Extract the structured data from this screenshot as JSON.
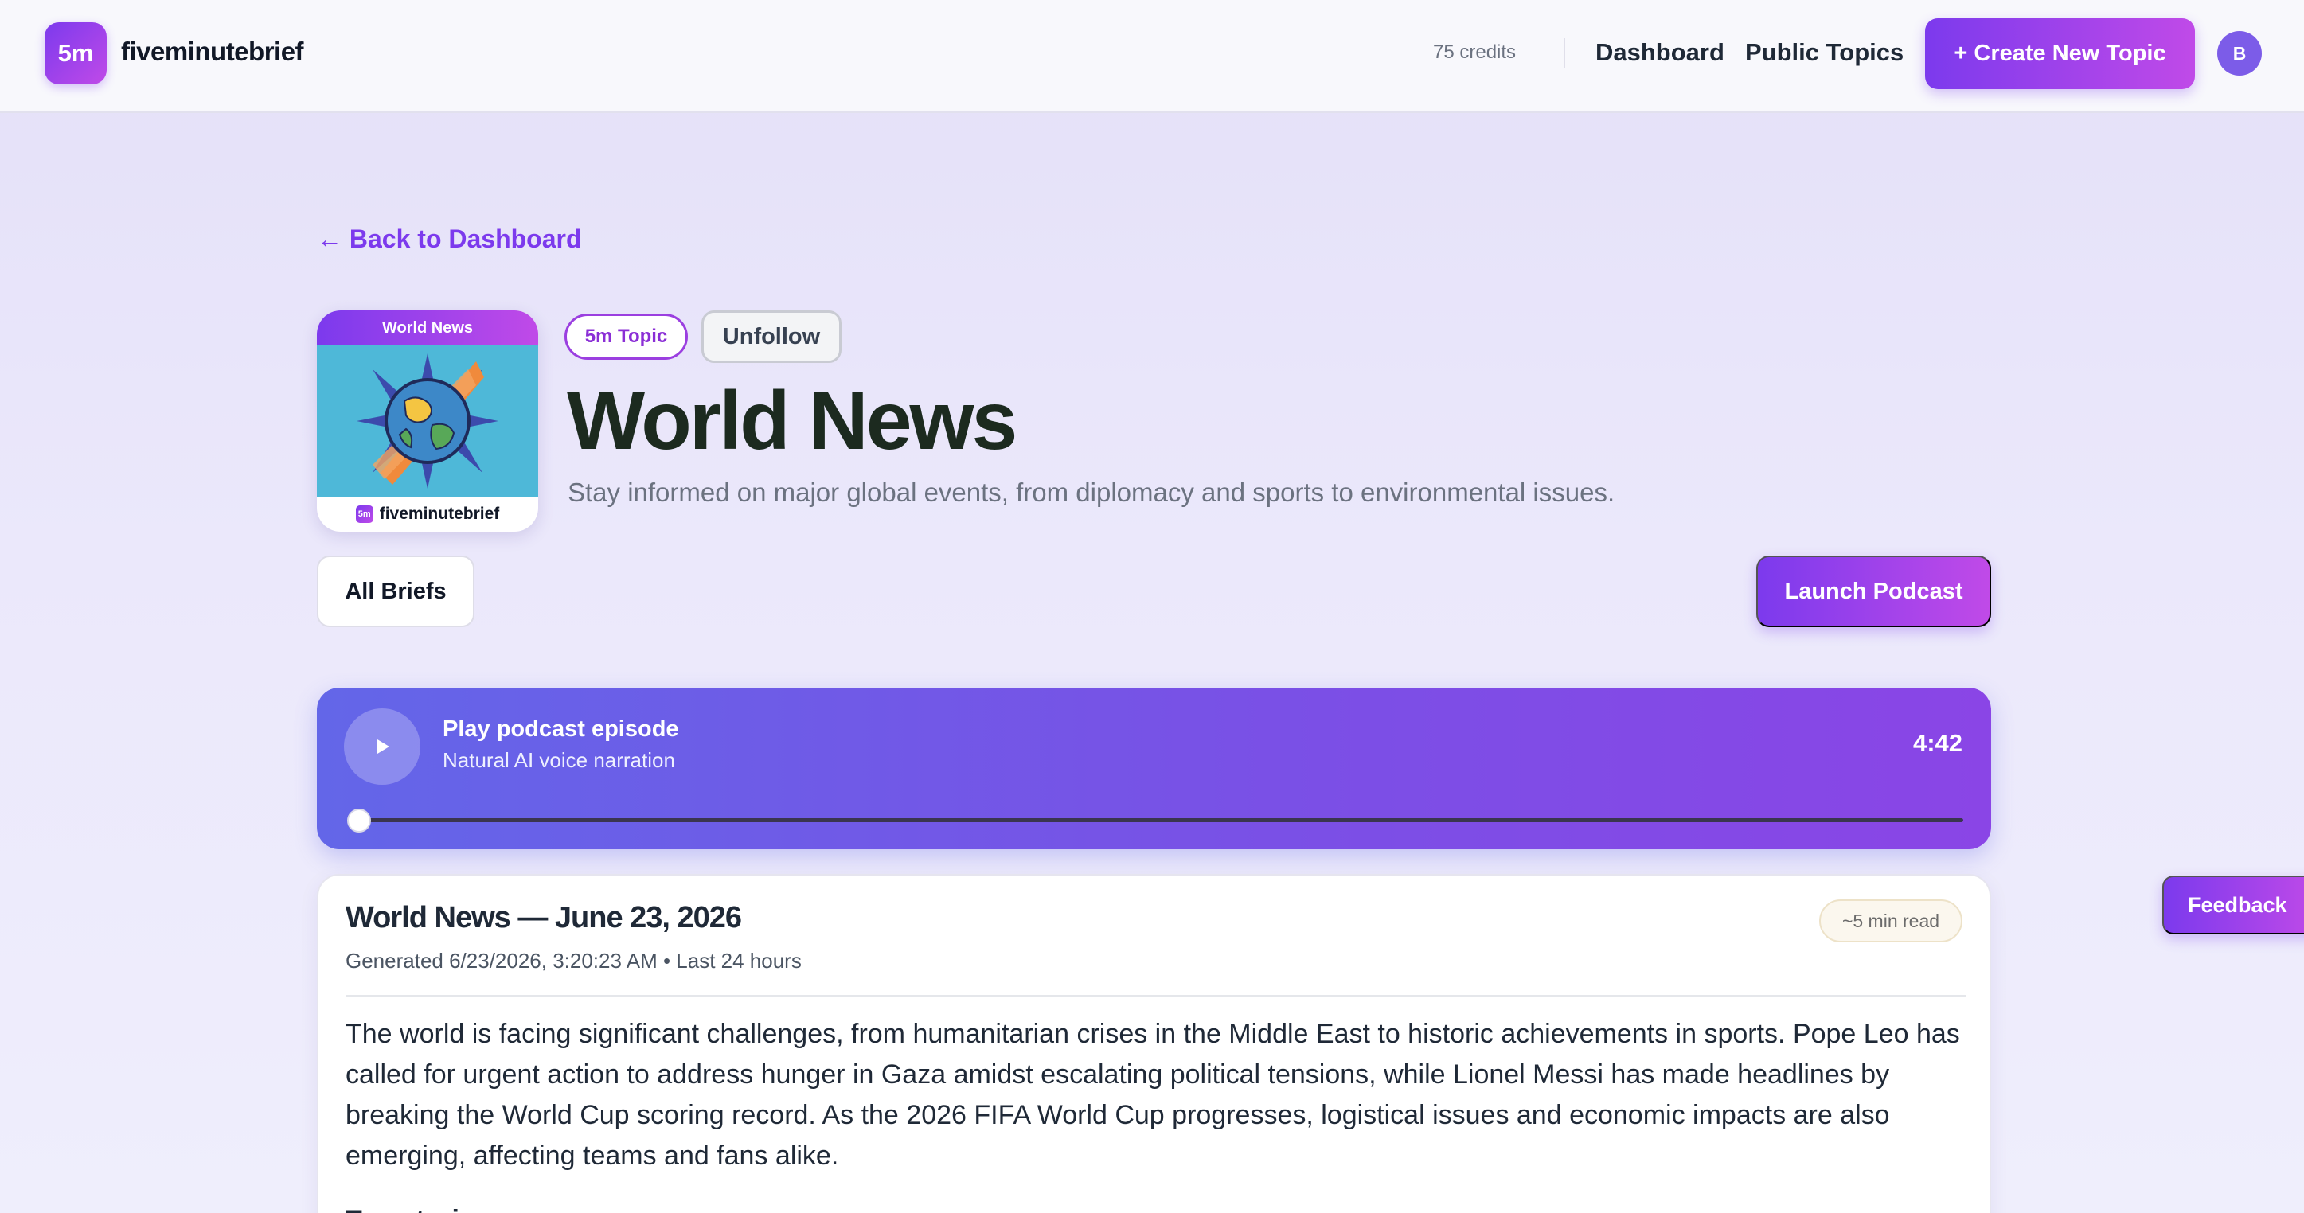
{
  "header": {
    "logo_badge": "5m",
    "brand": "fiveminutebrief",
    "credits": "75 credits",
    "nav": {
      "dashboard": "Dashboard",
      "public_topics": "Public Topics"
    },
    "create_button": "+ Create New Topic",
    "avatar_initial": "B"
  },
  "back_link": "← Back to Dashboard",
  "topic": {
    "cover": {
      "top_label": "World News",
      "badge": "5m",
      "brand": "fiveminutebrief"
    },
    "pill": "5m Topic",
    "unfollow": "Unfollow",
    "title": "World News",
    "description": "Stay informed on major global events, from diplomacy and sports to environmental issues."
  },
  "actions": {
    "all_briefs": "All Briefs",
    "launch_podcast": "Launch Podcast"
  },
  "player": {
    "title": "Play podcast episode",
    "subtitle": "Natural AI voice narration",
    "duration": "4:42",
    "progress": 0
  },
  "brief": {
    "title": "World News — June 23, 2026",
    "meta": "Generated 6/23/2026, 3:20:23 AM • Last 24 hours",
    "read_time": "~5 min read",
    "summary": "The world is facing significant challenges, from humanitarian crises in the Middle East to historic achievements in sports. Pope Leo has called for urgent action to address hunger in Gaza amidst escalating political tensions, while Lionel Messi has made headlines by breaking the World Cup scoring record. As the 2026 FIFA World Cup progresses, logistical issues and economic impacts are also emerging, affecting teams and fans alike.",
    "next_heading": "Top stories"
  },
  "feedback": "Feedback",
  "icons": {
    "back": "arrow-left-icon",
    "play": "play-icon"
  },
  "colors": {
    "accent": "#7c3aed",
    "accent_end": "#c04ae8",
    "player_start": "#6366e8",
    "player_end": "#8a45e6"
  }
}
